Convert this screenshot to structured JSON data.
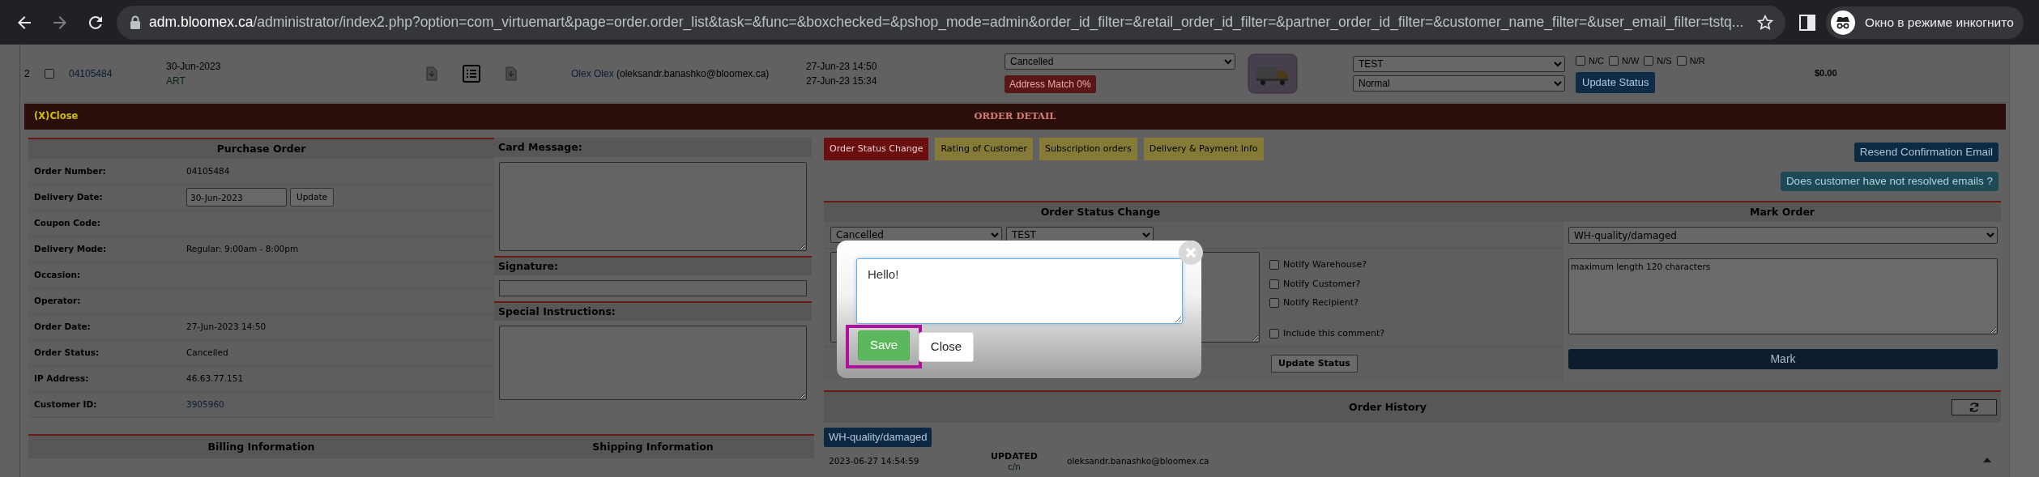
{
  "browser": {
    "host": "adm.bloomex.ca",
    "path": "/administrator/index2.php?option=com_virtuemart&page=order.order_list&task=&func=&boxchecked=&pshop_mode=admin&order_id_filter=&retail_order_id_filter=&partner_order_id_filter=&customer_name_filter=&user_email_filter=tstq...",
    "incognito_label": "Окно в режиме инкогнито"
  },
  "order_row": {
    "number": "2",
    "checked": false,
    "order_number": "04105484",
    "delivery_date": "30-Jun-2023",
    "tag": "ART",
    "customer_name": "Olex Olex",
    "customer_email": "(oleksandr.banashko@bloomex.ca)",
    "times": [
      "27-Jun-23 14:50",
      "27-Jun-23 15:34"
    ],
    "status": "Cancelled",
    "address_match": "Address Match 0%",
    "assignee": "TEST",
    "priority": "Normal",
    "flags": [
      {
        "label": "N/C",
        "checked": false
      },
      {
        "label": "N/W",
        "checked": false
      },
      {
        "label": "N/S",
        "checked": false
      },
      {
        "label": "N/R",
        "checked": false
      }
    ],
    "update_button": "Update Status",
    "total": "$0.00"
  },
  "order_detail": {
    "close": "(X)Close",
    "title": "ORDER DETAIL"
  },
  "purchase_order": {
    "title": "Purchase Order",
    "fields": [
      {
        "label": "Order Number:",
        "kind": "text",
        "value": "04105484"
      },
      {
        "label": "Delivery Date:",
        "kind": "date",
        "value": "30-Jun-2023",
        "button": "Update"
      },
      {
        "label": "Coupon Code:",
        "kind": "text"
      },
      {
        "label": "Delivery Mode:",
        "kind": "text",
        "value": "Regular: 9:00am - 8:00pm"
      },
      {
        "label": "Occasion:",
        "kind": "text"
      },
      {
        "label": "Operator:",
        "kind": "text"
      },
      {
        "label": "Order Date:",
        "kind": "text",
        "value": "27-Jun-2023 14:50"
      },
      {
        "label": "Order Status:",
        "kind": "text",
        "value": "Cancelled"
      },
      {
        "label": "IP Address:",
        "kind": "text",
        "value": "46.63.77.151"
      },
      {
        "label": "Customer ID:",
        "kind": "link",
        "value": "3905960"
      }
    ]
  },
  "card_message": {
    "title": "Card Message:"
  },
  "signature": {
    "title": "Signature:"
  },
  "special_instructions": {
    "title": "Special Instructions:"
  },
  "address": {
    "billing_title": "Billing Information",
    "shipping_title": "Shipping Information"
  },
  "tabs": [
    {
      "label": "Order Status Change",
      "selected": true
    },
    {
      "label": "Rating of Customer",
      "selected": false
    },
    {
      "label": "Subscription orders",
      "selected": false
    },
    {
      "label": "Delivery & Payment Info",
      "selected": false
    }
  ],
  "action_buttons": [
    {
      "label": "Resend Confirmation Email",
      "kind": "primary"
    },
    {
      "label": "Does customer have not resolved emails ?",
      "kind": "info"
    }
  ],
  "status_change": {
    "title": "Order Status Change",
    "status": "Cancelled",
    "assignee": "TEST",
    "options": [
      {
        "label": "Notify Warehouse?",
        "checked": false
      },
      {
        "label": "Notify Customer?",
        "checked": false
      },
      {
        "label": "Notify Recipient?",
        "checked": false
      },
      {
        "label": "Include this comment?",
        "checked": false
      }
    ],
    "update_button": "Update Status"
  },
  "mark_order": {
    "title": "Mark Order",
    "mark": "WH-quality/damaged",
    "comment_placeholder": "maximum length 120 characters",
    "button": "Mark"
  },
  "order_history": {
    "title": "Order History",
    "entries": [
      {
        "tag": "WH-quality/damaged",
        "time": "2023-06-27 14:54:59",
        "action": "UPDATED",
        "note": "c/n",
        "user": "oleksandr.banashko@bloomex.ca"
      }
    ]
  },
  "modal": {
    "comment": "Hello!",
    "save": "Save",
    "close": "Close",
    "save_highlighted": true
  }
}
